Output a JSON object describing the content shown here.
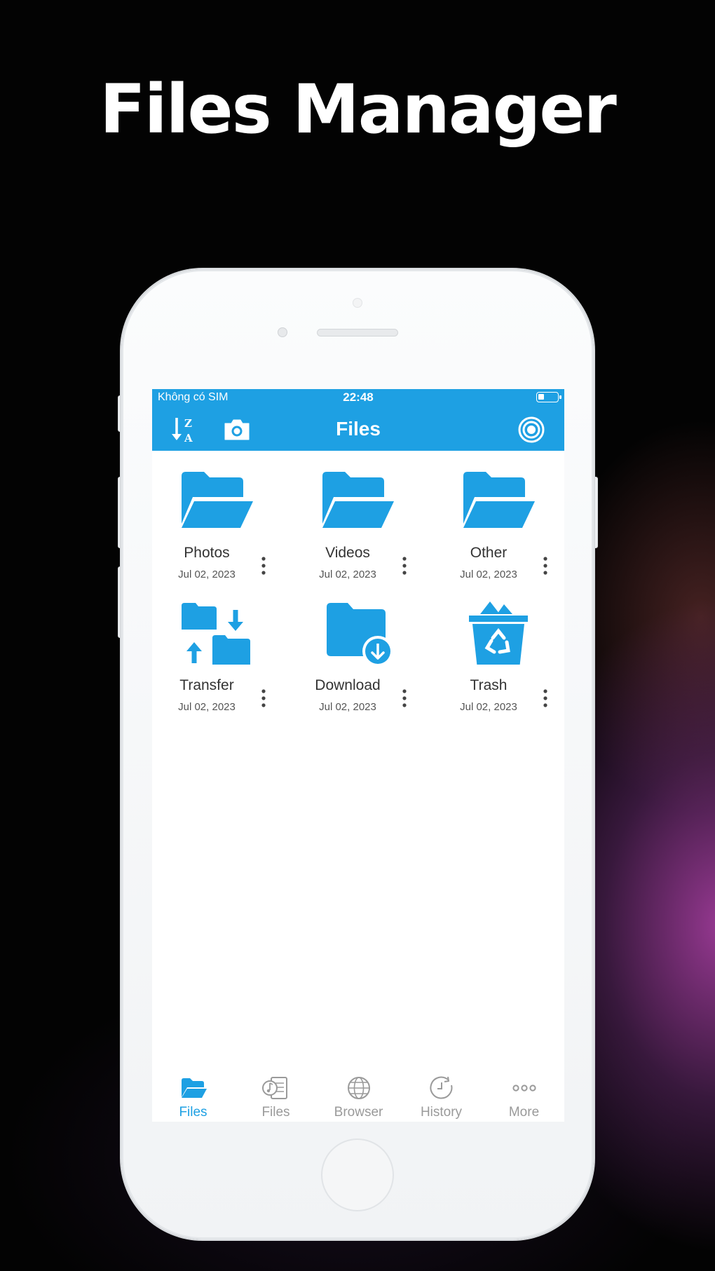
{
  "headline": "Files Manager",
  "status_bar": {
    "carrier": "Không có SIM",
    "time": "22:48",
    "battery_level": 0.3
  },
  "nav_bar": {
    "title": "Files",
    "sort_icon": "sort-z-a-icon",
    "camera_icon": "camera-icon",
    "target_icon": "target-icon"
  },
  "accent_color": "#1ea0e3",
  "folders": [
    {
      "name": "Photos",
      "date": "Jul 02, 2023",
      "icon": "folder-open-icon"
    },
    {
      "name": "Videos",
      "date": "Jul 02, 2023",
      "icon": "folder-open-icon"
    },
    {
      "name": "Other",
      "date": "Jul 02, 2023",
      "icon": "folder-open-icon"
    },
    {
      "name": "Transfer",
      "date": "Jul 02, 2023",
      "icon": "transfer-icon"
    },
    {
      "name": "Download",
      "date": "Jul 02, 2023",
      "icon": "folder-download-icon"
    },
    {
      "name": "Trash",
      "date": "Jul 02, 2023",
      "icon": "recycle-bin-icon"
    }
  ],
  "tabs": [
    {
      "label": "Files",
      "icon": "folder-icon",
      "active": true
    },
    {
      "label": "Files",
      "icon": "music-document-icon",
      "active": false
    },
    {
      "label": "Browser",
      "icon": "globe-icon",
      "active": false
    },
    {
      "label": "History",
      "icon": "clock-history-icon",
      "active": false
    },
    {
      "label": "More",
      "icon": "more-dots-icon",
      "active": false
    }
  ]
}
